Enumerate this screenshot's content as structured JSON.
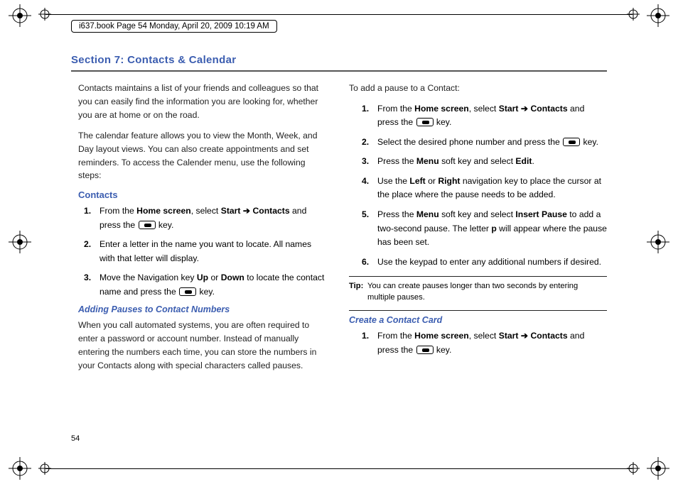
{
  "header": "i637.book  Page 54  Monday, April 20, 2009  10:19 AM",
  "section_title": "Section 7: Contacts & Calendar",
  "left": {
    "para1": "Contacts maintains a list of your friends and colleagues so that you can easily find the information you are looking for, whether you are at home or on the road.",
    "para2": "The calendar feature allows you to view the Month, Week, and Day layout views. You can also create appointments and set reminders. To access the Calender menu, use the following steps:",
    "contacts_head": "Contacts",
    "steps1": {
      "n1": "1.",
      "t1a": "From the ",
      "t1b": "Home screen",
      "t1c": ", select ",
      "t1d": "Start",
      "t1e": " ➔ ",
      "t1f": "Contacts",
      "t1g": " and press the ",
      "t1h": " key.",
      "n2": "2.",
      "t2": "Enter a letter in the name you want to locate. All names with that letter will display.",
      "n3": "3.",
      "t3a": "Move the Navigation key ",
      "t3b": "Up",
      "t3c": " or ",
      "t3d": "Down",
      "t3e": " to locate the contact name and press the ",
      "t3f": " key."
    },
    "pause_head": "Adding Pauses to Contact Numbers",
    "pause_para": "When you call automated systems, you are often required to enter a password or account number. Instead of manually entering the numbers each time, you can store the numbers in your Contacts along with special characters called pauses."
  },
  "right": {
    "intro": "To add a pause to a Contact:",
    "steps2": {
      "n1": "1.",
      "t1a": "From the ",
      "t1b": "Home screen",
      "t1c": ", select ",
      "t1d": "Start",
      "t1e": " ➔ ",
      "t1f": "Contacts",
      "t1g": " and press the ",
      "t1h": " key.",
      "n2": "2.",
      "t2a": "Select the desired phone number and press the ",
      "t2b": " key.",
      "n3": "3.",
      "t3a": "Press the ",
      "t3b": "Menu",
      "t3c": " soft key and select ",
      "t3d": "Edit",
      "t3e": ".",
      "n4": "4.",
      "t4a": "Use the ",
      "t4b": "Left",
      "t4c": " or ",
      "t4d": "Right",
      "t4e": " navigation key to place the cursor at the place where the pause needs to be added.",
      "n5": "5.",
      "t5a": "Press the ",
      "t5b": "Menu",
      "t5c": " soft key and select ",
      "t5d": "Insert Pause",
      "t5e": " to add a two-second pause. The letter ",
      "t5f": "p",
      "t5g": " will appear where the pause has been set.",
      "n6": "6.",
      "t6": "Use the keypad to enter any additional numbers if desired."
    },
    "tip_label": "Tip:",
    "tip_text": "You can create pauses longer than two seconds by entering multiple pauses.",
    "create_head": "Create a Contact Card",
    "steps3": {
      "n1": "1.",
      "t1a": "From the ",
      "t1b": "Home screen",
      "t1c": ", select ",
      "t1d": "Start",
      "t1e": " ➔ ",
      "t1f": "Contacts",
      "t1g": " and press the ",
      "t1h": " key."
    }
  },
  "pagenum": "54"
}
